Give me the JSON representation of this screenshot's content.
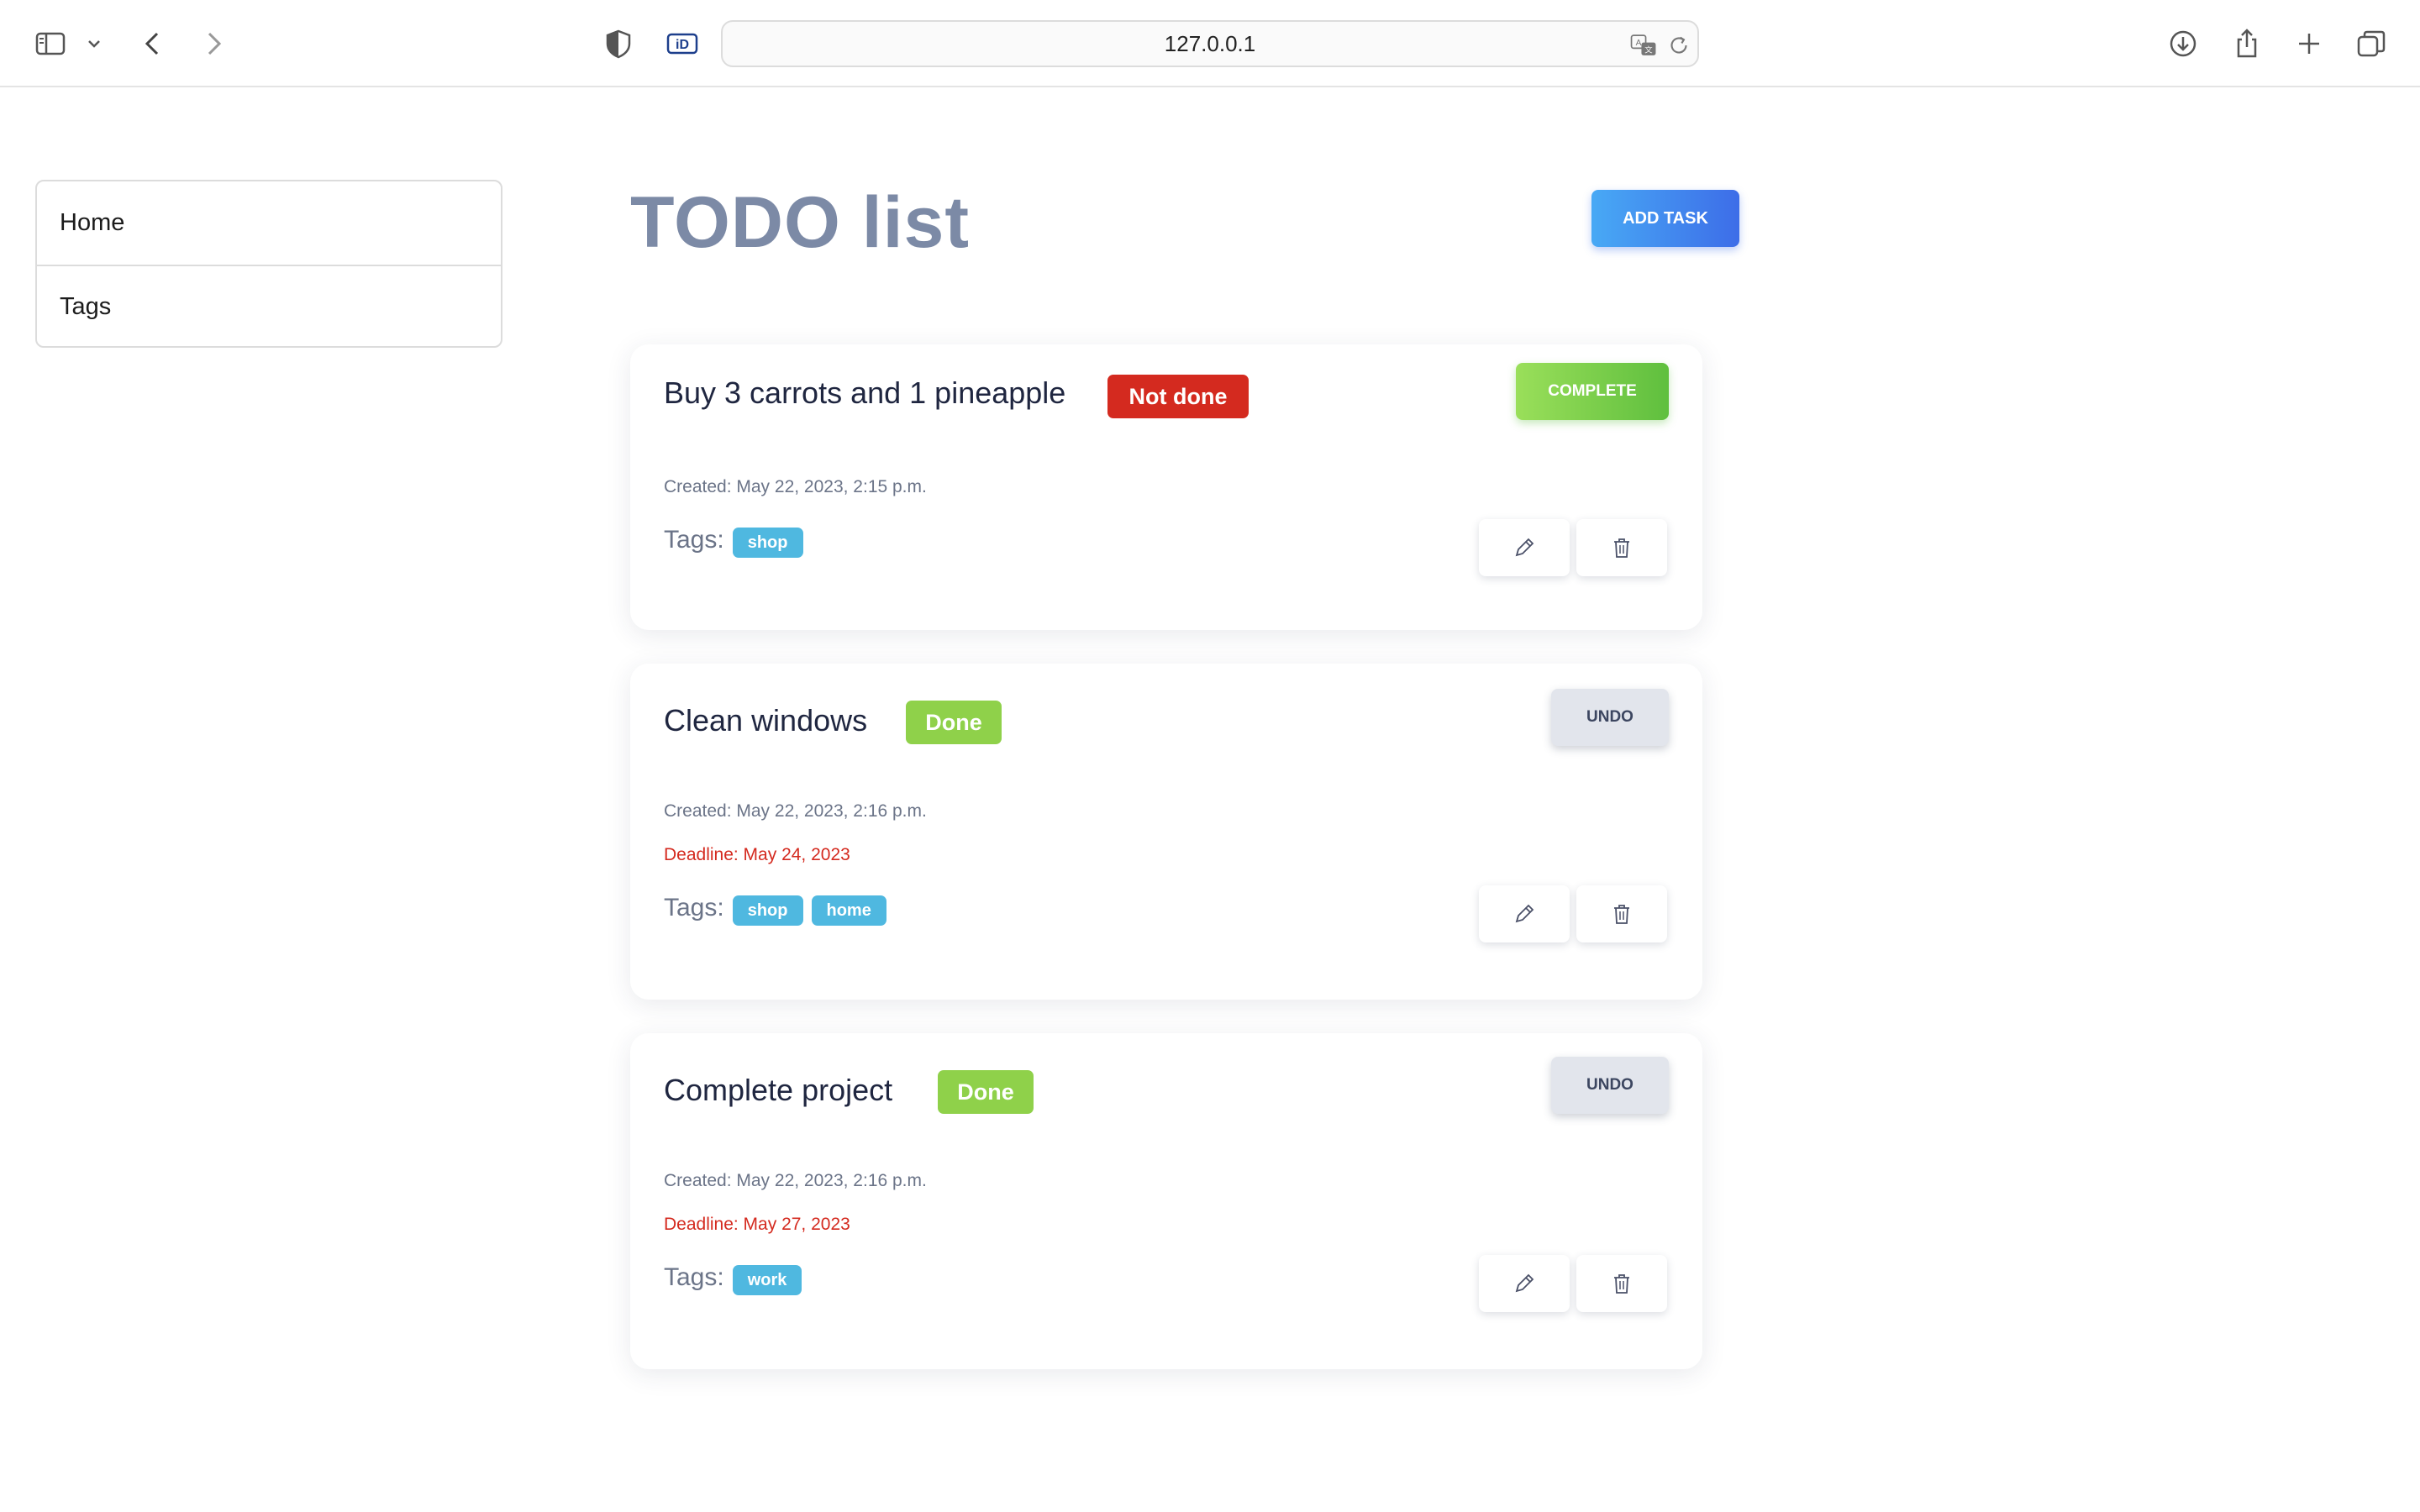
{
  "browser": {
    "url": "127.0.0.1",
    "icons": [
      "sidebar-toggle-icon",
      "chevron-down-icon",
      "back-arrow-icon",
      "forward-arrow-icon",
      "shield-icon",
      "id-extension-icon",
      "translate-icon",
      "reload-icon",
      "download-icon",
      "share-icon",
      "new-tab-plus-icon",
      "tab-overview-icon"
    ]
  },
  "sidebar": {
    "items": [
      {
        "label": "Home"
      },
      {
        "label": "Tags"
      }
    ]
  },
  "main": {
    "title": "TODO list",
    "add_button": "ADD TASK",
    "tags_label": "Tags:",
    "tasks": [
      {
        "title": "Buy 3 carrots and 1 pineapple",
        "status": "Not done",
        "action": "COMPLETE",
        "created": "Created: May 22, 2023, 2:15 p.m.",
        "tags": [
          "shop"
        ]
      },
      {
        "title": "Clean windows",
        "status": "Done",
        "action": "UNDO",
        "created": "Created: May 22, 2023, 2:16 p.m.",
        "deadline": "Deadline: May 24, 2023",
        "tags": [
          "shop",
          "home"
        ]
      },
      {
        "title": "Complete project",
        "status": "Done",
        "action": "UNDO",
        "created": "Created: May 22, 2023, 2:16 p.m.",
        "deadline": "Deadline: May 27, 2023",
        "tags": [
          "work"
        ]
      }
    ]
  },
  "colors": {
    "title": "#7c8aa6",
    "not_done": "#d42a1f",
    "done": "#8fd14a",
    "tag": "#4fb8e0",
    "add_button_gradient": [
      "#48a9f5",
      "#3d6de8"
    ],
    "complete_gradient": [
      "#9adf5a",
      "#5fbf3e"
    ]
  }
}
